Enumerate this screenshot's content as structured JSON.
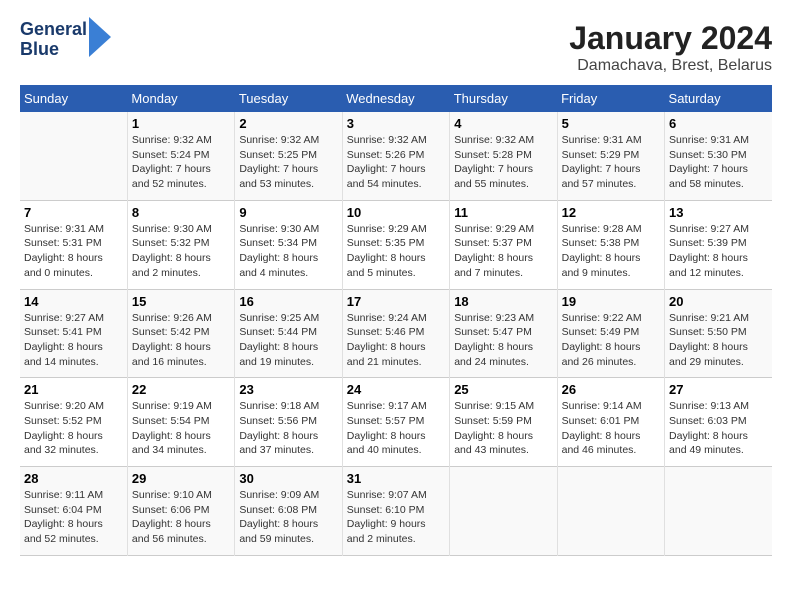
{
  "logo": {
    "line1": "General",
    "line2": "Blue"
  },
  "title": "January 2024",
  "location": "Damachava, Brest, Belarus",
  "days_header": [
    "Sunday",
    "Monday",
    "Tuesday",
    "Wednesday",
    "Thursday",
    "Friday",
    "Saturday"
  ],
  "weeks": [
    [
      {
        "day": "",
        "info": ""
      },
      {
        "day": "1",
        "info": "Sunrise: 9:32 AM\nSunset: 5:24 PM\nDaylight: 7 hours\nand 52 minutes."
      },
      {
        "day": "2",
        "info": "Sunrise: 9:32 AM\nSunset: 5:25 PM\nDaylight: 7 hours\nand 53 minutes."
      },
      {
        "day": "3",
        "info": "Sunrise: 9:32 AM\nSunset: 5:26 PM\nDaylight: 7 hours\nand 54 minutes."
      },
      {
        "day": "4",
        "info": "Sunrise: 9:32 AM\nSunset: 5:28 PM\nDaylight: 7 hours\nand 55 minutes."
      },
      {
        "day": "5",
        "info": "Sunrise: 9:31 AM\nSunset: 5:29 PM\nDaylight: 7 hours\nand 57 minutes."
      },
      {
        "day": "6",
        "info": "Sunrise: 9:31 AM\nSunset: 5:30 PM\nDaylight: 7 hours\nand 58 minutes."
      }
    ],
    [
      {
        "day": "7",
        "info": "Sunrise: 9:31 AM\nSunset: 5:31 PM\nDaylight: 8 hours\nand 0 minutes."
      },
      {
        "day": "8",
        "info": "Sunrise: 9:30 AM\nSunset: 5:32 PM\nDaylight: 8 hours\nand 2 minutes."
      },
      {
        "day": "9",
        "info": "Sunrise: 9:30 AM\nSunset: 5:34 PM\nDaylight: 8 hours\nand 4 minutes."
      },
      {
        "day": "10",
        "info": "Sunrise: 9:29 AM\nSunset: 5:35 PM\nDaylight: 8 hours\nand 5 minutes."
      },
      {
        "day": "11",
        "info": "Sunrise: 9:29 AM\nSunset: 5:37 PM\nDaylight: 8 hours\nand 7 minutes."
      },
      {
        "day": "12",
        "info": "Sunrise: 9:28 AM\nSunset: 5:38 PM\nDaylight: 8 hours\nand 9 minutes."
      },
      {
        "day": "13",
        "info": "Sunrise: 9:27 AM\nSunset: 5:39 PM\nDaylight: 8 hours\nand 12 minutes."
      }
    ],
    [
      {
        "day": "14",
        "info": "Sunrise: 9:27 AM\nSunset: 5:41 PM\nDaylight: 8 hours\nand 14 minutes."
      },
      {
        "day": "15",
        "info": "Sunrise: 9:26 AM\nSunset: 5:42 PM\nDaylight: 8 hours\nand 16 minutes."
      },
      {
        "day": "16",
        "info": "Sunrise: 9:25 AM\nSunset: 5:44 PM\nDaylight: 8 hours\nand 19 minutes."
      },
      {
        "day": "17",
        "info": "Sunrise: 9:24 AM\nSunset: 5:46 PM\nDaylight: 8 hours\nand 21 minutes."
      },
      {
        "day": "18",
        "info": "Sunrise: 9:23 AM\nSunset: 5:47 PM\nDaylight: 8 hours\nand 24 minutes."
      },
      {
        "day": "19",
        "info": "Sunrise: 9:22 AM\nSunset: 5:49 PM\nDaylight: 8 hours\nand 26 minutes."
      },
      {
        "day": "20",
        "info": "Sunrise: 9:21 AM\nSunset: 5:50 PM\nDaylight: 8 hours\nand 29 minutes."
      }
    ],
    [
      {
        "day": "21",
        "info": "Sunrise: 9:20 AM\nSunset: 5:52 PM\nDaylight: 8 hours\nand 32 minutes."
      },
      {
        "day": "22",
        "info": "Sunrise: 9:19 AM\nSunset: 5:54 PM\nDaylight: 8 hours\nand 34 minutes."
      },
      {
        "day": "23",
        "info": "Sunrise: 9:18 AM\nSunset: 5:56 PM\nDaylight: 8 hours\nand 37 minutes."
      },
      {
        "day": "24",
        "info": "Sunrise: 9:17 AM\nSunset: 5:57 PM\nDaylight: 8 hours\nand 40 minutes."
      },
      {
        "day": "25",
        "info": "Sunrise: 9:15 AM\nSunset: 5:59 PM\nDaylight: 8 hours\nand 43 minutes."
      },
      {
        "day": "26",
        "info": "Sunrise: 9:14 AM\nSunset: 6:01 PM\nDaylight: 8 hours\nand 46 minutes."
      },
      {
        "day": "27",
        "info": "Sunrise: 9:13 AM\nSunset: 6:03 PM\nDaylight: 8 hours\nand 49 minutes."
      }
    ],
    [
      {
        "day": "28",
        "info": "Sunrise: 9:11 AM\nSunset: 6:04 PM\nDaylight: 8 hours\nand 52 minutes."
      },
      {
        "day": "29",
        "info": "Sunrise: 9:10 AM\nSunset: 6:06 PM\nDaylight: 8 hours\nand 56 minutes."
      },
      {
        "day": "30",
        "info": "Sunrise: 9:09 AM\nSunset: 6:08 PM\nDaylight: 8 hours\nand 59 minutes."
      },
      {
        "day": "31",
        "info": "Sunrise: 9:07 AM\nSunset: 6:10 PM\nDaylight: 9 hours\nand 2 minutes."
      },
      {
        "day": "",
        "info": ""
      },
      {
        "day": "",
        "info": ""
      },
      {
        "day": "",
        "info": ""
      }
    ]
  ]
}
